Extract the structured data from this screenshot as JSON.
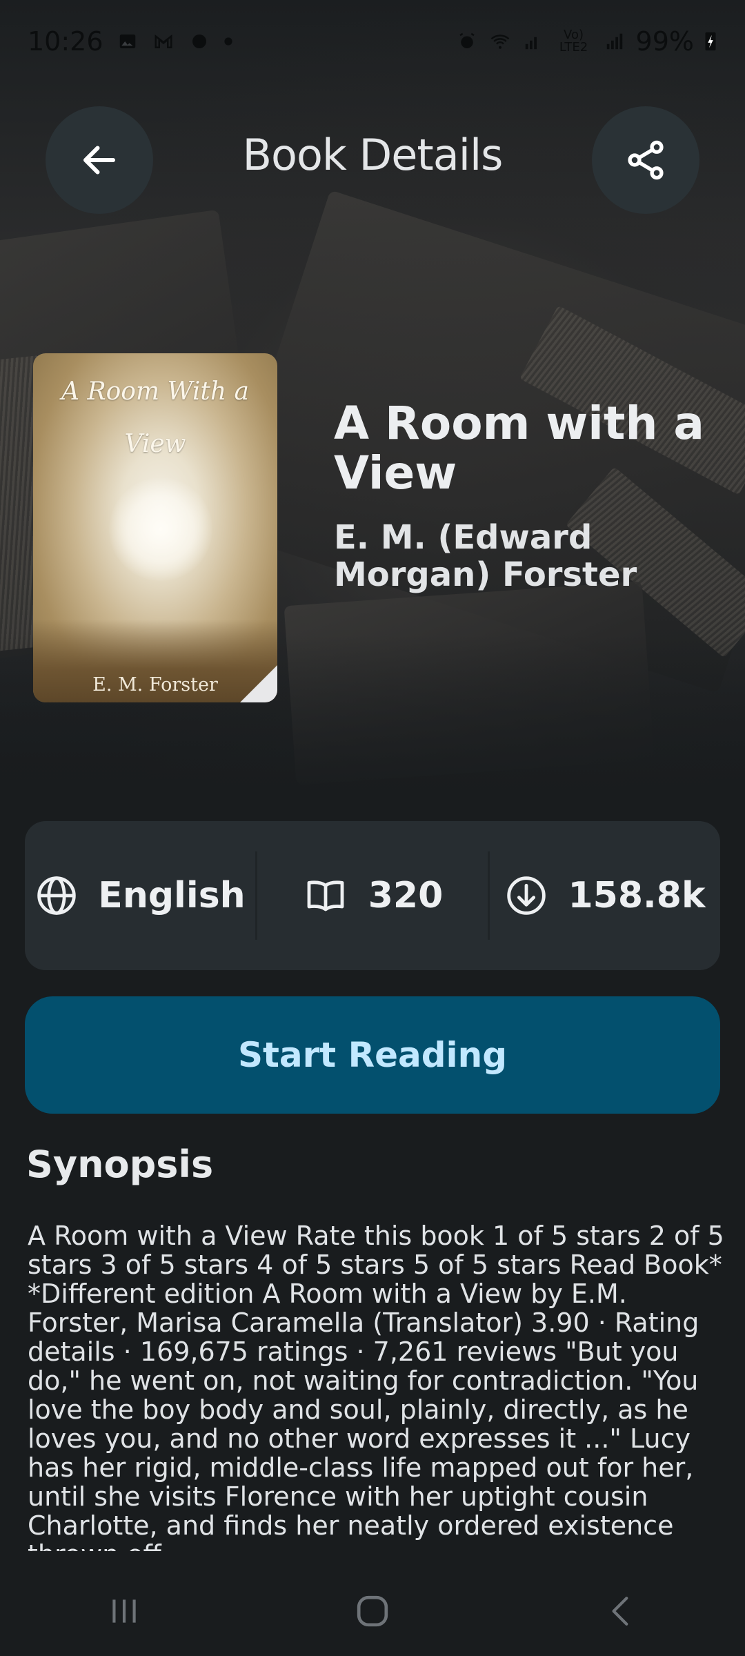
{
  "status_bar": {
    "time": "10:26",
    "network_label": "Vo) LTE2",
    "battery": "99%"
  },
  "header": {
    "title": "Book Details",
    "back_icon": "arrow-left-icon",
    "share_icon": "share-icon"
  },
  "book": {
    "cover_title": "A Room With a View",
    "cover_author": "E. M. Forster",
    "title": "A Room with a View",
    "author": "E. M. (Edward Morgan) Forster"
  },
  "stats": {
    "language": "English",
    "pages": "320",
    "downloads": "158.8k"
  },
  "actions": {
    "start_reading": "Start Reading"
  },
  "synopsis": {
    "heading": "Synopsis",
    "text": "A Room with a View Rate this book 1 of 5 stars 2 of 5 stars 3 of 5 stars 4 of 5 stars 5 of 5 stars Read Book* *Different edition A Room with a View by E.M. Forster, Marisa Caramella (Translator) 3.90 · Rating details · 169,675 ratings · 7,261 reviews \"But you do,\" he went on, not waiting for contradiction. \"You love the boy body and soul, plainly, directly, as he loves you, and no other word expresses it ...\" Lucy has her rigid, middle-class life mapped out for her, until she visits Florence with her uptight cousin Charlotte, and finds her neatly ordered existence thrown off"
  },
  "colors": {
    "background": "#191c1e",
    "card": "#272d31",
    "primary_button": "#03506e",
    "primary_text": "#c2e8ff"
  }
}
